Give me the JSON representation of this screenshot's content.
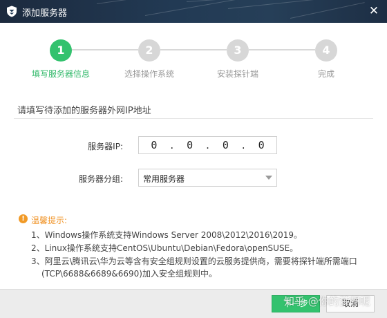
{
  "window": {
    "title": "添加服务器",
    "logo_icon": "shield-icon",
    "close_glyph": "✕"
  },
  "steps": [
    {
      "number": "1",
      "label": "填写服务器信息",
      "active": true
    },
    {
      "number": "2",
      "label": "选择操作系统",
      "active": false
    },
    {
      "number": "3",
      "label": "安装探针端",
      "active": false
    },
    {
      "number": "4",
      "label": "完成",
      "active": false
    }
  ],
  "section": {
    "title": "请填写待添加的服务器外网IP地址"
  },
  "form": {
    "ip_label": "服务器IP:",
    "ip_segments": [
      "0",
      "0",
      "0",
      "0"
    ],
    "ip_separator": ".",
    "group_label": "服务器分组:",
    "group_value": "常用服务器"
  },
  "tips": {
    "icon": "!",
    "title": "温馨提示:",
    "lines": [
      "1、Windows操作系统支持Windows Server 2008\\2012\\2016\\2019。",
      "2、Linux操作系统支持CentOS\\Ubuntu\\Debian\\Fedora\\openSUSE。",
      "3、阿里云\\腾讯云\\华为云等含有安全组规则设置的云服务提供商，需要将探针端所需端口",
      "(TCP\\6688&6689&6690)加入安全组规则中。"
    ]
  },
  "footer": {
    "next_label": "下一步",
    "cancel_label": "取消",
    "watermark": "知乎 @你的梦想呢"
  },
  "colors": {
    "accent": "#33c26e",
    "tip": "#f0952a",
    "titlebar": "#223a54"
  }
}
